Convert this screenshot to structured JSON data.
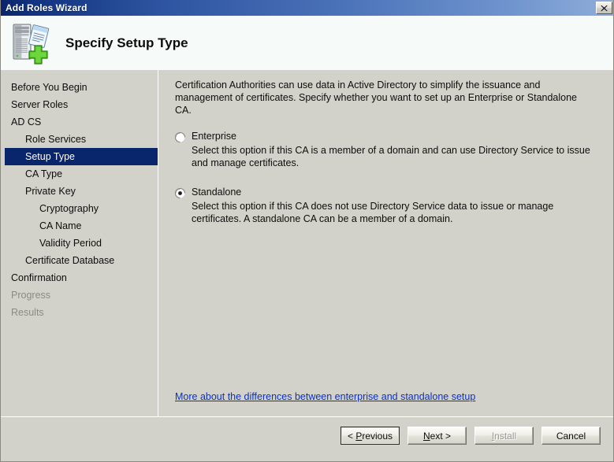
{
  "window": {
    "title": "Add Roles Wizard",
    "close_icon": "close-icon",
    "close_label": "Close"
  },
  "header": {
    "title": "Specify Setup Type",
    "icon": "server-certificate-add-icon"
  },
  "sidebar": {
    "items": [
      {
        "label": "Before You Begin",
        "level": 0,
        "state": "normal"
      },
      {
        "label": "Server Roles",
        "level": 0,
        "state": "normal"
      },
      {
        "label": "AD CS",
        "level": 0,
        "state": "normal"
      },
      {
        "label": "Role Services",
        "level": 1,
        "state": "normal"
      },
      {
        "label": "Setup Type",
        "level": 1,
        "state": "selected"
      },
      {
        "label": "CA Type",
        "level": 1,
        "state": "normal"
      },
      {
        "label": "Private Key",
        "level": 1,
        "state": "normal"
      },
      {
        "label": "Cryptography",
        "level": 2,
        "state": "normal"
      },
      {
        "label": "CA Name",
        "level": 2,
        "state": "normal"
      },
      {
        "label": "Validity Period",
        "level": 2,
        "state": "normal"
      },
      {
        "label": "Certificate Database",
        "level": 1,
        "state": "normal"
      },
      {
        "label": "Confirmation",
        "level": 0,
        "state": "normal"
      },
      {
        "label": "Progress",
        "level": 0,
        "state": "disabled"
      },
      {
        "label": "Results",
        "level": 0,
        "state": "disabled"
      }
    ]
  },
  "content": {
    "intro": "Certification Authorities can use data in Active Directory to simplify the issuance and management of certificates. Specify whether you want to set up an Enterprise or Standalone CA.",
    "options": [
      {
        "label": "Enterprise",
        "selected": false,
        "description": "Select this option if this CA is a member of a domain and can use Directory Service to issue and manage certificates."
      },
      {
        "label": "Standalone",
        "selected": true,
        "description": "Select this option if this CA does not use Directory Service data to issue or manage certificates. A standalone CA can be a member of a domain."
      }
    ],
    "help_link": "More about the differences between enterprise and standalone setup"
  },
  "footer": {
    "buttons": [
      {
        "label": "< Previous",
        "accel": "P",
        "state": "default"
      },
      {
        "label": "Next >",
        "accel": "N",
        "state": "normal"
      },
      {
        "label": "Install",
        "accel": "I",
        "state": "disabled"
      },
      {
        "label": "Cancel",
        "accel": "",
        "state": "normal"
      }
    ]
  },
  "colors": {
    "titlebar_start": "#0a246a",
    "titlebar_end": "#8fadd9",
    "dialog_bg": "#d2d2ca",
    "header_bg": "#f6faf8",
    "selection_bg": "#09256b",
    "link": "#0a31c9",
    "disabled_text": "#8b8b84"
  }
}
